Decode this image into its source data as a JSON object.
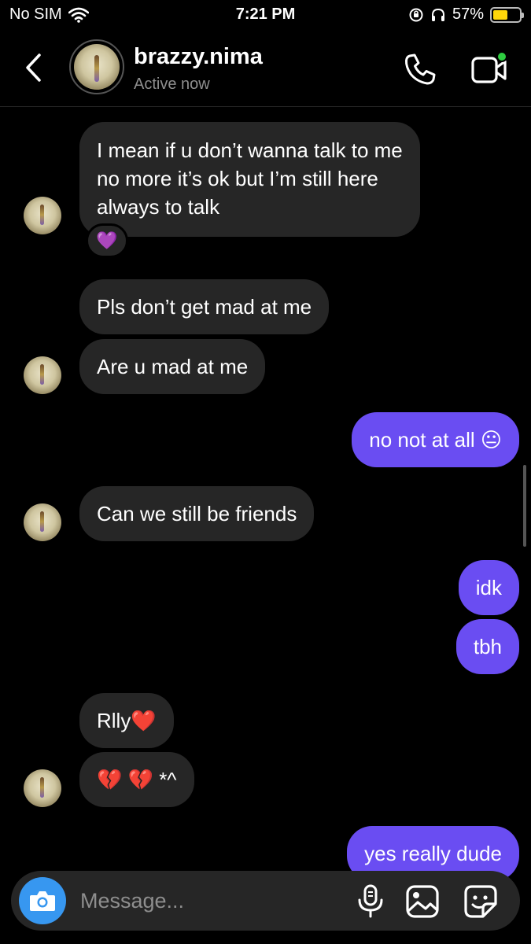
{
  "status_bar": {
    "carrier": "No SIM",
    "time": "7:21 PM",
    "battery": "57%",
    "battery_level": 0.57
  },
  "header": {
    "username": "brazzy.nima",
    "status": "Active now"
  },
  "messages": [
    {
      "dir": "in",
      "text": "I mean if u don’t wanna talk to me\nno more it’s ok but I’m still here\nalways to talk",
      "reaction": "💜"
    },
    {
      "dir": "in",
      "text": "Pls don’t get mad at me"
    },
    {
      "dir": "in",
      "text": "Are u mad at me"
    },
    {
      "dir": "out",
      "text": "no not at all 😐"
    },
    {
      "dir": "in",
      "text": "Can we still be friends"
    },
    {
      "dir": "out",
      "text": "idk"
    },
    {
      "dir": "out",
      "text": "tbh"
    },
    {
      "dir": "in",
      "text": "Rlly❤️"
    },
    {
      "dir": "in",
      "text": "💔 💔 *^"
    },
    {
      "dir": "out",
      "text": "yes really dude"
    }
  ],
  "composer": {
    "placeholder": "Message..."
  },
  "colors": {
    "outgoing": "#6a4df2",
    "incoming": "#262626",
    "camera": "#3797f0",
    "online_dot": "#2ecc40"
  },
  "icons": [
    "back-chevron-icon",
    "phone-icon",
    "video-call-icon",
    "camera-icon",
    "microphone-icon",
    "gallery-icon",
    "sticker-icon",
    "wifi-icon",
    "battery-icon"
  ]
}
